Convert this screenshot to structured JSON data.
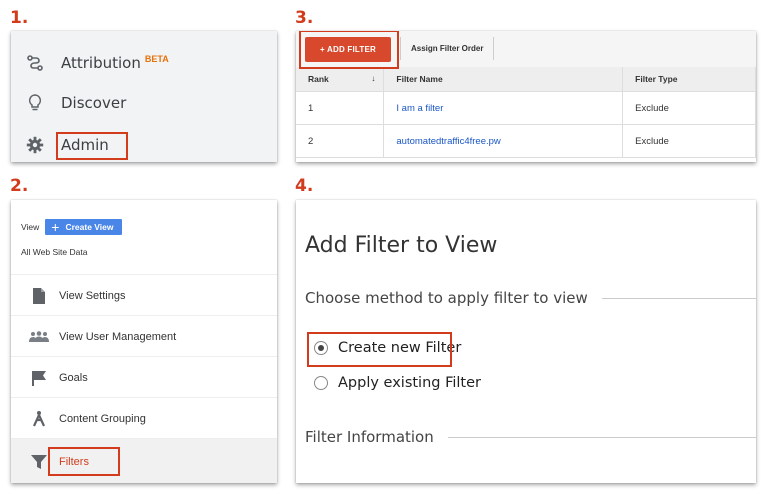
{
  "steps": {
    "s1": "1.",
    "s2": "2.",
    "s3": "3.",
    "s4": "4."
  },
  "panel1": {
    "items": [
      {
        "label": "Attribution",
        "badge": "BETA",
        "icon": "attribution-icon"
      },
      {
        "label": "Discover",
        "icon": "lightbulb-icon"
      },
      {
        "label": "Admin",
        "icon": "gear-icon"
      }
    ]
  },
  "panel3": {
    "add_filter": "+ ADD FILTER",
    "assign_order": "Assign Filter Order",
    "columns": [
      "Rank",
      "Filter Name",
      "Filter Type"
    ],
    "sort_indicator": "↓",
    "rows": [
      {
        "rank": "1",
        "name": "I am a filter",
        "type": "Exclude"
      },
      {
        "rank": "2",
        "name": "automatedtraffic4free.pw",
        "type": "Exclude"
      }
    ]
  },
  "panel2": {
    "view_label": "View",
    "create_view": "Create View",
    "create_plus": "+",
    "site_data": "All Web Site Data",
    "items": [
      {
        "label": "View Settings",
        "icon": "document-icon"
      },
      {
        "label": "View User Management",
        "icon": "users-icon"
      },
      {
        "label": "Goals",
        "icon": "flag-icon"
      },
      {
        "label": "Content Grouping",
        "icon": "person-walk-icon"
      },
      {
        "label": "Filters",
        "icon": "filter-icon"
      }
    ]
  },
  "panel4": {
    "title": "Add Filter to View",
    "method_heading": "Choose method to apply filter to view",
    "options": [
      {
        "label": "Create new Filter",
        "selected": true
      },
      {
        "label": "Apply existing Filter",
        "selected": false
      }
    ],
    "info_heading": "Filter Information"
  },
  "colors": {
    "highlight": "#d23b1c",
    "add_button": "#d7482c",
    "create_button": "#4a86e8",
    "link": "#1a57c5"
  }
}
